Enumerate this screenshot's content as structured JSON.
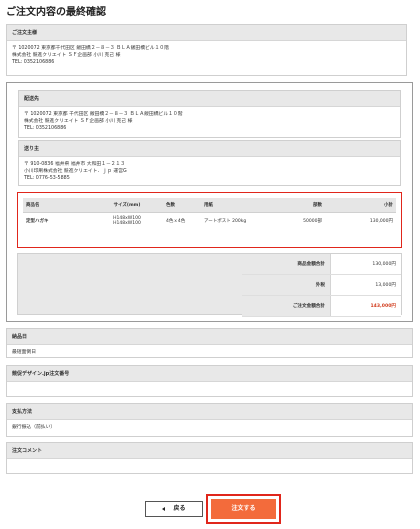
{
  "page_title": "ご注文内容の最終確認",
  "orderer": {
    "header": "ご注文主様",
    "lines": [
      "〒 1020072 東京都千代田区 飯田橋２－８－３ ＢＬＡ飯田橋ビル１０階",
      "株式会社 競進クリエイト ＳＦ企画部 小川 克己 様",
      "TEL: 0352106886"
    ]
  },
  "delivery": {
    "header": "配送先",
    "lines": [
      "〒 1020072 東京都 千代田区 飯田橋２－８－３ ＢＬＡ飯田橋ビル１０階",
      "株式会社 競進クリエイト ＳＦ企画部 小川 克己 様",
      "TEL: 0352106886"
    ]
  },
  "sender": {
    "header": "送り主",
    "lines": [
      "〒 910-0836 福井県 福井市 大和田１－２１３",
      "小川印刷株式会社 競進クリエイト．ｊｐ 運営G",
      "TEL: 0776-53-5885"
    ]
  },
  "items_table": {
    "headers": [
      "商品名",
      "サイズ(mm)",
      "色数",
      "用紙",
      "部数",
      "小計"
    ],
    "row": {
      "name": "定型ハガキ",
      "size_line1": "H148xW100",
      "size_line2": "H148xW100",
      "colors": "4色ｘ4色",
      "paper": "アートポスト 200kg",
      "quantity": "50000部",
      "subtotal": "130,000円"
    }
  },
  "totals": {
    "product_label": "商品金額合計",
    "product_value": "130,000円",
    "tax_label": "外税",
    "tax_value": "13,000円",
    "total_label": "ご注文金額合計",
    "total_value": "143,000円"
  },
  "delivery_date": {
    "header": "納品日",
    "value": "最短面倒日"
  },
  "order_number": {
    "header": "競促デザイン.jp注文番号",
    "value": ""
  },
  "payment": {
    "header": "支払方法",
    "value": "銀行振込（前払い）"
  },
  "comment": {
    "header": "注文コメント",
    "value": ""
  },
  "buttons": {
    "back_label": "戻る",
    "submit_label": "注文する"
  },
  "colors": {
    "highlight_red": "#e0261b",
    "accent_orange": "#f36b3b",
    "total_red": "#d23e1f"
  }
}
